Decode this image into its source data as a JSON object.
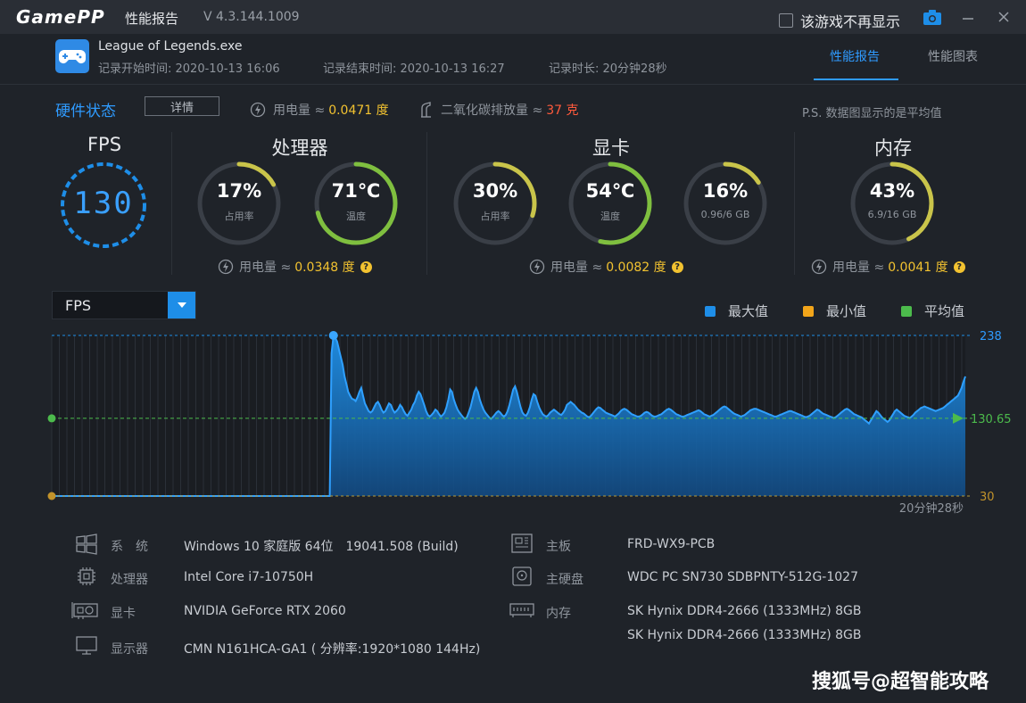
{
  "titlebar": {
    "logo": "GamePP",
    "title": "性能报告",
    "version": "V 4.3.144.1009",
    "dont_show_label": "该游戏不再显示"
  },
  "session": {
    "game_name": "League of Legends.exe",
    "start": "记录开始时间: 2020-10-13 16:06",
    "end": "记录结束时间: 2020-10-13 16:27",
    "duration": "记录时长: 20分钟28秒"
  },
  "tabs": [
    {
      "label": "性能报告",
      "active": true
    },
    {
      "label": "性能图表",
      "active": false
    }
  ],
  "hardware_status": {
    "title": "硬件状态",
    "detail_button": "详情",
    "power_label": "用电量 ≈",
    "power_value": "0.0471 度",
    "co2_label": "二氧化碳排放量 ≈",
    "co2_value": "37 克",
    "note": "P.S. 数据图显示的是平均值"
  },
  "fps": {
    "title": "FPS",
    "value": "130"
  },
  "cpu": {
    "title": "处理器",
    "usage": {
      "value": "17%",
      "label": "占用率",
      "fraction": 0.17
    },
    "temp": {
      "value": "71℃",
      "label": "温度",
      "fraction": 0.71
    },
    "power_label": "用电量 ≈",
    "power_value": "0.0348 度"
  },
  "gpu": {
    "title": "显卡",
    "usage": {
      "value": "30%",
      "label": "占用率",
      "fraction": 0.3
    },
    "temp": {
      "value": "54℃",
      "label": "温度",
      "fraction": 0.54
    },
    "vram": {
      "value": "16%",
      "label": "0.96/6 GB",
      "fraction": 0.16
    },
    "power_label": "用电量 ≈",
    "power_value": "0.0082 度"
  },
  "memory": {
    "title": "内存",
    "usage": {
      "value": "43%",
      "label": "6.9/16 GB",
      "fraction": 0.43
    },
    "power_label": "用电量 ≈",
    "power_value": "0.0041 度"
  },
  "chart_controls": {
    "metric_select": "FPS",
    "legend": [
      {
        "label": "最大值",
        "color": "#1e8ee8"
      },
      {
        "label": "最小值",
        "color": "#f2a51a"
      },
      {
        "label": "平均值",
        "color": "#4cbb4c"
      }
    ]
  },
  "chart_data": {
    "type": "area",
    "ylim": [
      30,
      238
    ],
    "max_label": "238",
    "avg_label": "130.65",
    "min_label": "30",
    "x_end_label": "20分钟28秒",
    "series": [
      {
        "values": [
          30,
          30,
          30,
          30,
          30,
          30,
          30,
          30,
          30,
          30,
          30,
          30,
          30,
          30,
          30,
          30,
          30,
          30,
          30,
          30,
          30,
          30,
          30,
          30,
          30,
          30,
          30,
          30,
          30,
          30,
          30,
          30,
          30,
          30,
          30,
          30,
          30,
          30,
          30,
          30,
          30,
          30,
          30,
          30,
          30,
          30,
          30,
          30,
          30,
          30,
          30,
          30,
          30,
          30,
          30,
          30,
          30,
          30,
          30,
          30,
          30,
          30,
          30,
          30,
          30,
          30,
          30,
          30,
          30,
          30,
          30,
          30,
          30,
          30,
          30,
          30,
          30,
          30,
          30,
          30,
          30,
          30,
          30,
          30,
          30,
          30,
          30,
          30,
          30,
          30,
          30,
          30,
          30,
          30,
          30,
          30,
          30,
          30,
          30,
          30,
          30,
          30,
          30,
          30,
          30,
          30,
          30,
          30,
          30,
          30,
          30,
          30,
          30,
          30,
          30,
          30,
          30,
          30,
          30,
          30,
          30,
          30,
          30,
          30,
          30,
          30,
          30,
          30,
          30,
          30,
          30,
          30,
          30,
          30,
          30,
          30,
          30,
          30,
          30,
          30,
          30,
          30,
          30,
          30,
          30,
          30,
          30,
          30,
          30,
          30,
          30,
          215,
          236,
          235,
          230,
          220,
          210,
          200,
          185,
          175,
          165,
          160,
          156,
          155,
          153,
          158,
          165,
          170,
          160,
          150,
          145,
          140,
          138,
          140,
          145,
          150,
          152,
          148,
          142,
          138,
          140,
          145,
          150,
          148,
          142,
          138,
          140,
          143,
          148,
          145,
          140,
          136,
          134,
          138,
          142,
          148,
          152,
          160,
          165,
          162,
          155,
          148,
          140,
          135,
          133,
          135,
          138,
          142,
          140,
          136,
          133,
          135,
          138,
          145,
          155,
          168,
          165,
          155,
          148,
          142,
          138,
          135,
          132,
          130,
          132,
          138,
          145,
          155,
          165,
          170,
          165,
          155,
          148,
          142,
          138,
          135,
          132,
          130,
          132,
          135,
          138,
          140,
          138,
          135,
          133,
          135,
          140,
          148,
          158,
          168,
          172,
          165,
          155,
          145,
          138,
          135,
          134,
          138,
          145,
          155,
          162,
          160,
          152,
          145,
          140,
          136,
          134,
          133,
          135,
          138,
          140,
          142,
          140,
          138,
          136,
          135,
          138,
          142,
          148,
          150,
          152,
          150,
          148,
          145,
          142,
          140,
          138,
          137,
          135,
          133,
          132,
          134,
          137,
          140,
          143,
          145,
          144,
          142,
          140,
          138,
          137,
          136,
          135,
          134,
          133,
          135,
          137,
          140,
          142,
          143,
          142,
          140,
          138,
          136,
          135,
          134,
          133,
          133,
          134,
          136,
          138,
          139,
          138,
          136,
          134,
          133,
          133,
          134,
          135,
          136,
          138,
          140,
          142,
          143,
          142,
          140,
          138,
          136,
          135,
          134,
          133,
          133,
          134,
          135,
          136,
          137,
          138,
          139,
          140,
          141,
          140,
          138,
          136,
          135,
          134,
          133,
          134,
          135,
          137,
          139,
          141,
          143,
          145,
          146,
          145,
          143,
          141,
          139,
          137,
          136,
          135,
          134,
          133,
          134,
          135,
          137,
          139,
          141,
          142,
          143,
          143,
          142,
          141,
          140,
          139,
          138,
          137,
          136,
          135,
          134,
          133,
          133,
          134,
          135,
          136,
          137,
          138,
          139,
          140,
          140,
          139,
          138,
          137,
          136,
          135,
          134,
          133,
          132,
          133,
          134,
          136,
          138,
          140,
          142,
          141,
          139,
          137,
          136,
          135,
          134,
          133,
          132,
          131,
          132,
          134,
          136,
          138,
          140,
          142,
          143,
          142,
          140,
          138,
          136,
          135,
          134,
          133,
          132,
          130,
          128,
          126,
          124,
          128,
          132,
          136,
          140,
          138,
          135,
          132,
          130,
          128,
          126,
          128,
          132,
          136,
          140,
          142,
          140,
          138,
          136,
          134,
          133,
          132,
          131,
          133,
          135,
          138,
          140,
          142,
          144,
          145,
          146,
          145,
          144,
          143,
          142,
          141,
          140,
          141,
          142,
          143,
          144,
          146,
          148,
          150,
          152,
          154,
          156,
          158,
          160,
          165,
          170,
          178,
          185
        ]
      }
    ]
  },
  "system_info": {
    "left": [
      {
        "label": "系　统",
        "value": "Windows 10 家庭版 64位　19041.508 (Build)"
      },
      {
        "label": "处理器",
        "value": "Intel Core i7-10750H"
      },
      {
        "label": "显卡",
        "value": "NVIDIA GeForce RTX 2060"
      },
      {
        "label": "显示器",
        "value": "CMN N161HCA-GA1 ( 分辨率:1920*1080 144Hz)"
      }
    ],
    "right": [
      {
        "label": "主板",
        "value": "FRD-WX9-PCB"
      },
      {
        "label": "主硬盘",
        "value": "WDC PC SN730 SDBPNTY-512G-1027"
      },
      {
        "label": "内存",
        "value": "SK Hynix DDR4-2666 (1333MHz) 8GB"
      },
      {
        "label": "",
        "value": "SK Hynix DDR4-2666 (1333MHz) 8GB"
      }
    ]
  },
  "watermark": "搜狐号@超智能攻略"
}
